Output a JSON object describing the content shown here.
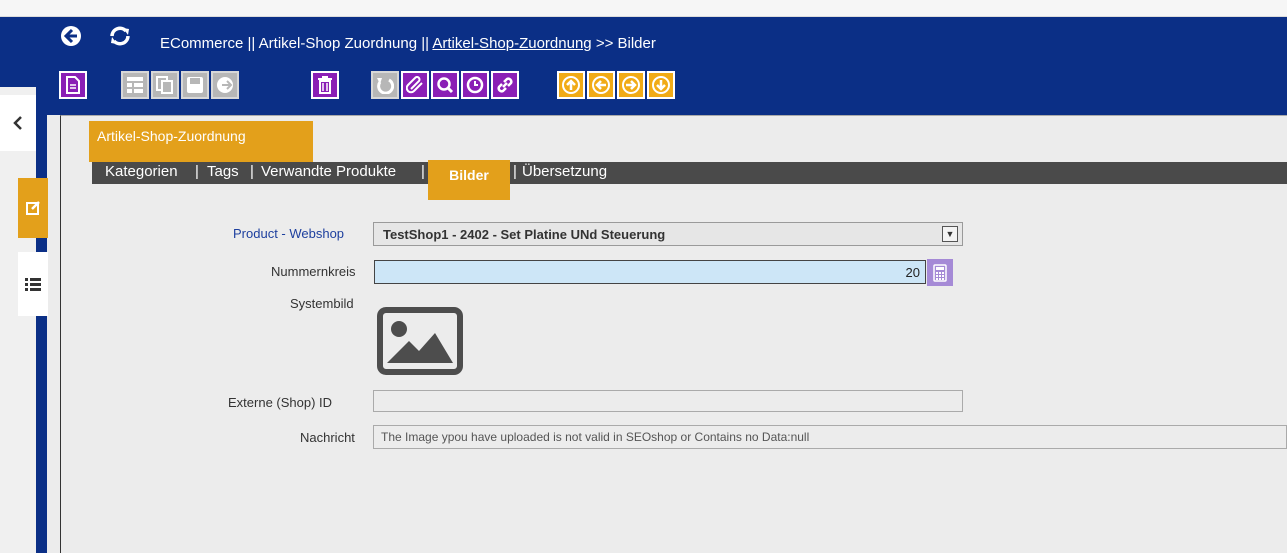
{
  "header": {
    "title_prefix": "ECommerce || Artikel-Shop Zuordnung  ||",
    "title_link": "Artikel-Shop-Zuordnung",
    "title_suffix": ">>  Bilder"
  },
  "toolbar": {
    "buttons": [
      {
        "icon": "new-document-icon",
        "color": "purple"
      },
      {
        "icon": "list-view-icon",
        "color": "gray"
      },
      {
        "icon": "copy-icon",
        "color": "gray"
      },
      {
        "icon": "save-icon",
        "color": "gray"
      },
      {
        "icon": "save-exit-icon",
        "color": "gray"
      },
      {
        "icon": "delete-icon",
        "color": "purple"
      },
      {
        "icon": "undo-icon",
        "color": "gray"
      },
      {
        "icon": "attachment-icon",
        "color": "purple"
      },
      {
        "icon": "search-icon",
        "color": "purple"
      },
      {
        "icon": "history-icon",
        "color": "purple"
      },
      {
        "icon": "link-icon",
        "color": "purple"
      },
      {
        "icon": "arrow-up-icon",
        "color": "orange"
      },
      {
        "icon": "arrow-left-icon",
        "color": "orange"
      },
      {
        "icon": "arrow-right-icon",
        "color": "orange"
      },
      {
        "icon": "arrow-down-icon",
        "color": "orange"
      }
    ]
  },
  "module_tab": "Artikel-Shop-Zuordnung",
  "tabs": {
    "kategorien": "Kategorien",
    "sep1": "|",
    "tags": "Tags",
    "sep2": "|",
    "verwandte": "Verwandte Produkte",
    "sep3": "|",
    "active": "Bilder",
    "sep4": "|",
    "uebersetzung": "Übersetzung"
  },
  "form": {
    "webshop_label": "Product - Webshop",
    "webshop_value": "TestShop1 - 2402 - Set Platine UNd Steuerung",
    "nummernkreis_label": "Nummernkreis",
    "nummernkreis_value": "20",
    "systembild_label": "Systembild",
    "externe_label": "Externe (Shop) ID",
    "externe_value": "",
    "nachricht_label": "Nachricht",
    "nachricht_value": "The Image ypou have uploaded is not valid in SEOshop or Contains no Data:null"
  },
  "colors": {
    "frame_blue": "#0b2f86",
    "accent_orange": "#e3a01b",
    "toolbar_purple": "#8a1fb5",
    "toolbar_orange": "#f1ab16",
    "input_blue": "#cde6f7"
  }
}
